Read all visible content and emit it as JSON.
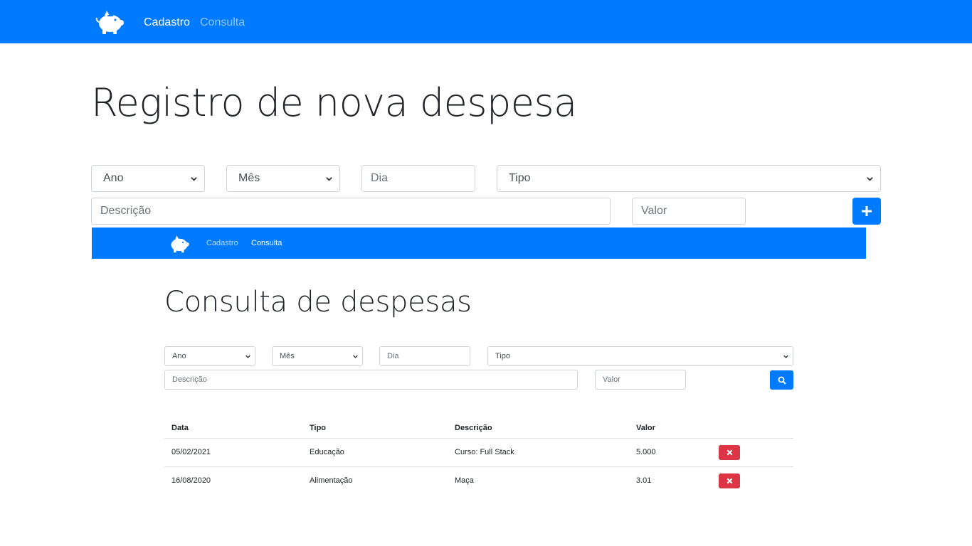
{
  "navbar": {
    "brand_icon": "piggy-bank-icon",
    "links": [
      {
        "label": "Cadastro",
        "active": true
      },
      {
        "label": "Consulta",
        "active": false
      }
    ],
    "color": "#007bff"
  },
  "page": {
    "title": "Registro de nova despesa"
  },
  "form": {
    "ano_select": "Ano",
    "mes_select": "Mês",
    "dia_placeholder": "Dia",
    "tipo_select": "Tipo",
    "descricao_placeholder": "Descrição",
    "valor_placeholder": "Valor",
    "add_icon": "plus-icon"
  },
  "embedded": {
    "navbar": {
      "links": [
        {
          "label": "Cadastro",
          "active": false
        },
        {
          "label": "Consulta",
          "active": true
        }
      ]
    },
    "title": "Consulta de despesas",
    "filters": {
      "ano_select": "Ano",
      "mes_select": "Mês",
      "dia_placeholder": "Dia",
      "tipo_select": "Tipo",
      "descricao_placeholder": "Descrição",
      "valor_placeholder": "Valor",
      "search_icon": "search-icon"
    },
    "table": {
      "headers": [
        "Data",
        "Tipo",
        "Descrição",
        "Valor",
        ""
      ],
      "rows": [
        {
          "data": "05/02/2021",
          "tipo": "Educação",
          "descricao": "Curso: Full Stack",
          "valor": "5.000"
        },
        {
          "data": "16/08/2020",
          "tipo": "Alimentação",
          "descricao": "Maça",
          "valor": "3.01"
        }
      ],
      "delete_icon": "x-icon",
      "delete_color": "#dc3545"
    }
  }
}
